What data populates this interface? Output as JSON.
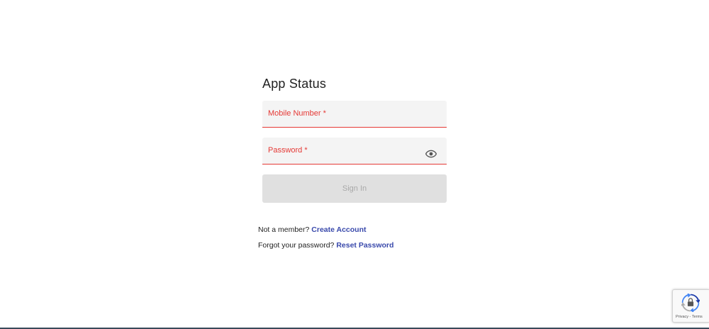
{
  "form": {
    "title": "App Status",
    "mobile_label": "Mobile Number *",
    "password_label": "Password *",
    "signin_label": "Sign In"
  },
  "links": {
    "member_prompt": "Not a member?",
    "create_account": "Create Account",
    "forgot_prompt": "Forgot your password?",
    "reset_password": "Reset Password"
  },
  "recaptcha": {
    "terms_text": "Privacy - Terms"
  },
  "colors": {
    "accent_red": "#e53935",
    "link_blue": "#3949ab",
    "disabled_button": "#e0e0e0"
  },
  "icons": {
    "password_toggle": "eye-icon",
    "recaptcha": "recaptcha-logo-icon"
  }
}
